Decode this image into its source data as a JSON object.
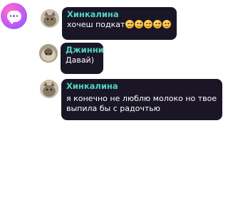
{
  "chat": {
    "messages": [
      {
        "author": "Хинкалина",
        "text": "хочеш подкат"
      },
      {
        "author": "Джинни",
        "text": "Давай)"
      },
      {
        "author": "Хинкалина",
        "text": "я конечно не люблю молоко но твое выпила бы с радочтью"
      }
    ],
    "reaction_icon": "grinning-face-emoji",
    "colors": {
      "bubble_bg": "#1a1626",
      "author_name": "#4fd6c4",
      "text": "#ffffff",
      "fab_gradient_start": "#ff6ec4",
      "fab_gradient_end": "#7b5cff"
    }
  },
  "fab": {
    "icon": "chat-bubble-icon"
  }
}
